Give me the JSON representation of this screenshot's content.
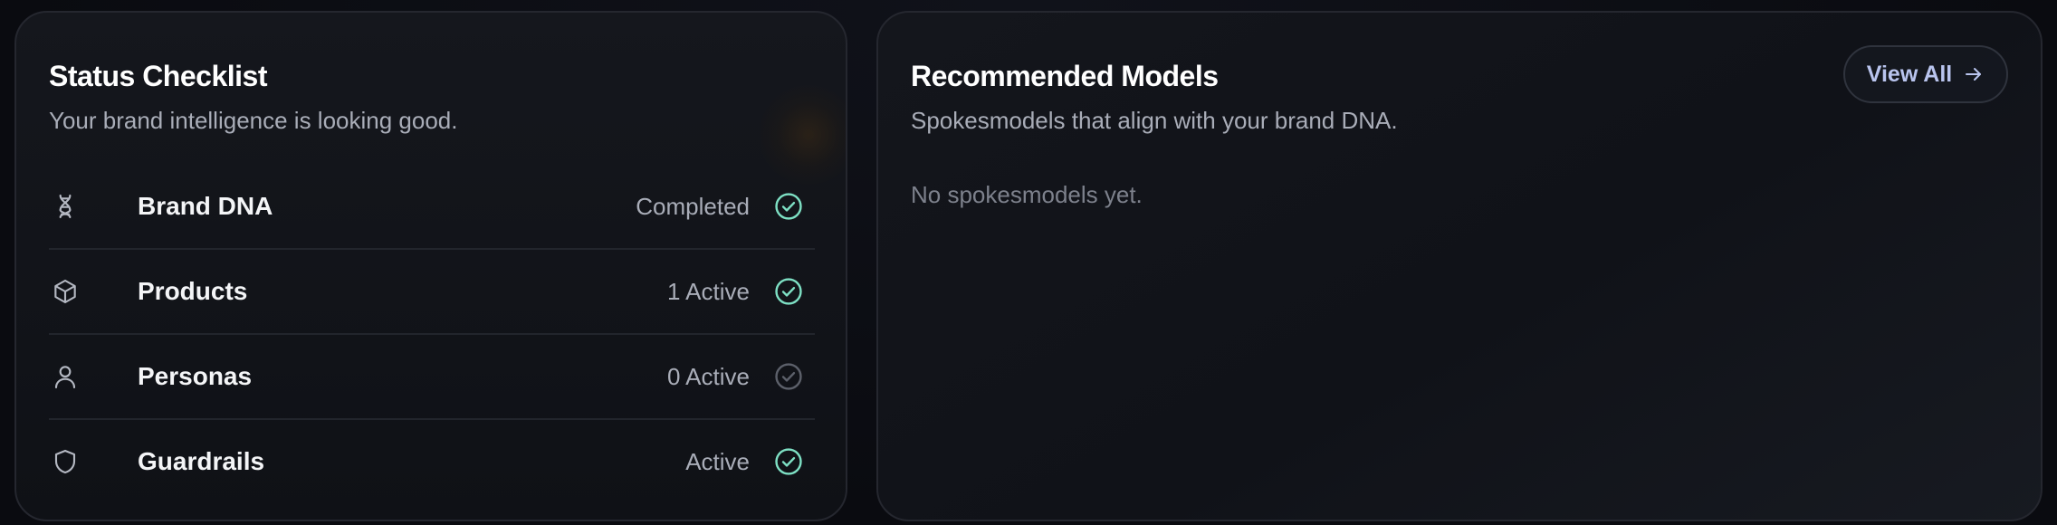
{
  "status_checklist": {
    "title": "Status Checklist",
    "subtitle": "Your brand intelligence is looking good.",
    "items": [
      {
        "label": "Brand DNA",
        "status": "Completed",
        "icon": "dna-icon",
        "state": "complete"
      },
      {
        "label": "Products",
        "status": "1 Active",
        "icon": "box-icon",
        "state": "complete"
      },
      {
        "label": "Personas",
        "status": "0 Active",
        "icon": "user-icon",
        "state": "inactive"
      },
      {
        "label": "Guardrails",
        "status": "Active",
        "icon": "shield-icon",
        "state": "complete"
      }
    ]
  },
  "recommended_models": {
    "title": "Recommended Models",
    "subtitle": "Spokesmodels that align with your brand DNA.",
    "view_all_label": "View All",
    "empty_message": "No spokesmodels yet."
  },
  "colors": {
    "check_complete": "#7ee0c4",
    "check_inactive": "#5c606a",
    "accent_link": "#b9c4ee"
  }
}
